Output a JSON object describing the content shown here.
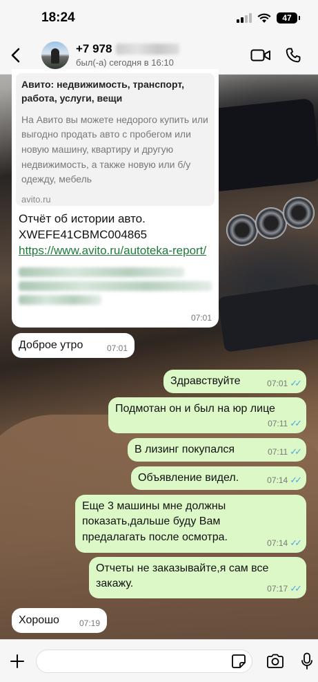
{
  "status_bar": {
    "time": "18:24",
    "battery": "47"
  },
  "header": {
    "contact_name": "+7 978",
    "last_seen": "был(-а) сегодня в 16:10"
  },
  "link_preview": {
    "title": "Авито: недвижимость, транспорт, работа, услуги, вещи",
    "description": "На Авито вы можете недорого купить или выгодно продать авто с пробегом или новую машину, квартиру и другую недвижимость, а также новую или б/у одежду, мебель",
    "domain": "avito.ru",
    "text_line1": "Отчёт об истории авто.",
    "text_line2": "XWEFE41CBMC004865",
    "url": "https://www.avito.ru/autoteka-report/",
    "time": "07:01"
  },
  "messages": [
    {
      "dir": "in",
      "text": "Доброе утро",
      "time": "07:01"
    },
    {
      "dir": "out",
      "text": "Здравствуйте",
      "time": "07:01"
    },
    {
      "dir": "out",
      "text": "Подмотан он и был на юр лице",
      "time": "07:11"
    },
    {
      "dir": "out",
      "text": "В лизинг покупался",
      "time": "07:11"
    },
    {
      "dir": "out",
      "text": "Объявление видел.",
      "time": "07:14"
    },
    {
      "dir": "out",
      "text": "Еще 3 машины мне должны показать,дальше буду Вам предалагать после осмотра.",
      "time": "07:14"
    },
    {
      "dir": "out",
      "text": "Отчеты не заказывайте,я сам все закажу.",
      "time": "07:17"
    },
    {
      "dir": "in",
      "text": "Хорошо",
      "time": "07:19"
    }
  ],
  "icons": {
    "back": "chevron-left-icon",
    "video": "video-camera-icon",
    "call": "phone-icon",
    "attach": "plus-icon",
    "sticker": "sticker-icon",
    "camera": "camera-icon",
    "mic": "microphone-icon",
    "read": "double-check-icon"
  },
  "colors": {
    "outgoing_bubble": "#dcf8c6",
    "incoming_bubble": "#ffffff",
    "read_ticks": "#4fa8ea",
    "link": "#1f7a3a"
  }
}
